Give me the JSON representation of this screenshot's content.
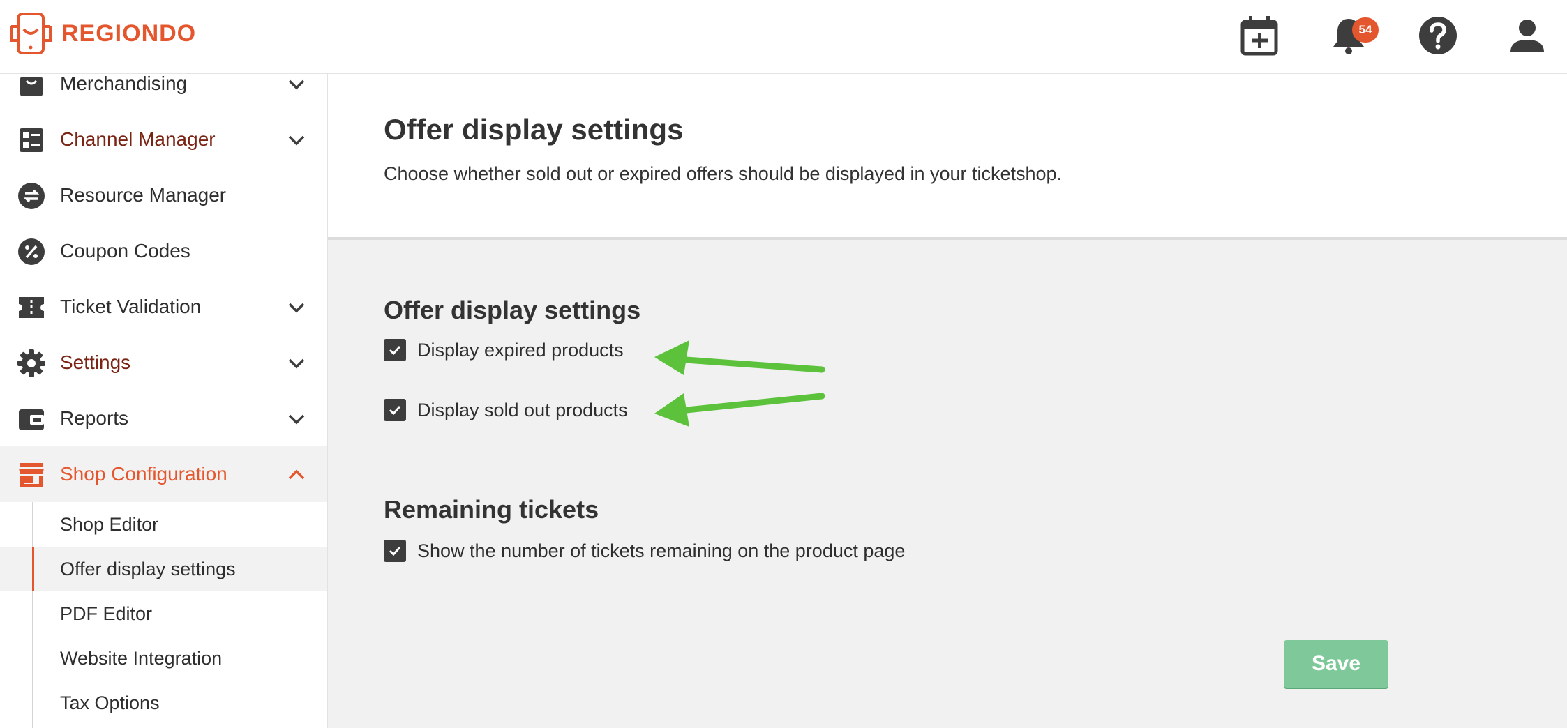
{
  "brand": {
    "name": "REGIONDO",
    "color": "#e4572e"
  },
  "topbar": {
    "notification_count": "54",
    "icons": [
      "calendar-add-icon",
      "bell-icon",
      "help-icon",
      "user-icon"
    ]
  },
  "sidebar": {
    "items": [
      {
        "label": "Merchandising",
        "icon": "shopping-bag-icon",
        "has_chevron": true
      },
      {
        "label": "Channel Manager",
        "icon": "dashboard-list-icon",
        "has_chevron": true
      },
      {
        "label": "Resource Manager",
        "icon": "swap-arrows-icon",
        "has_chevron": false
      },
      {
        "label": "Coupon Codes",
        "icon": "percent-icon",
        "has_chevron": false
      },
      {
        "label": "Ticket Validation",
        "icon": "ticket-icon",
        "has_chevron": true
      },
      {
        "label": "Settings",
        "icon": "gear-icon",
        "has_chevron": true
      },
      {
        "label": "Reports",
        "icon": "wallet-icon",
        "has_chevron": true
      },
      {
        "label": "Shop Configuration",
        "icon": "store-icon",
        "has_chevron": true
      }
    ],
    "subitems": [
      {
        "label": "Shop Editor"
      },
      {
        "label": "Offer display settings"
      },
      {
        "label": "PDF Editor"
      },
      {
        "label": "Website Integration"
      },
      {
        "label": "Tax Options"
      }
    ]
  },
  "main": {
    "title": "Offer display settings",
    "description": "Choose whether sold out or expired offers should be displayed in your ticketshop.",
    "sections": [
      {
        "title": "Offer display settings",
        "options": [
          {
            "label": "Display expired products",
            "checked": true
          },
          {
            "label": "Display sold out products",
            "checked": true
          }
        ]
      },
      {
        "title": "Remaining tickets",
        "options": [
          {
            "label": "Show the number of tickets remaining on the product page",
            "checked": true
          }
        ]
      }
    ],
    "save_label": "Save"
  },
  "colors": {
    "accent": "#e4572e",
    "annotation_arrow": "#5cc23c",
    "save_button": "#7ec89a"
  }
}
